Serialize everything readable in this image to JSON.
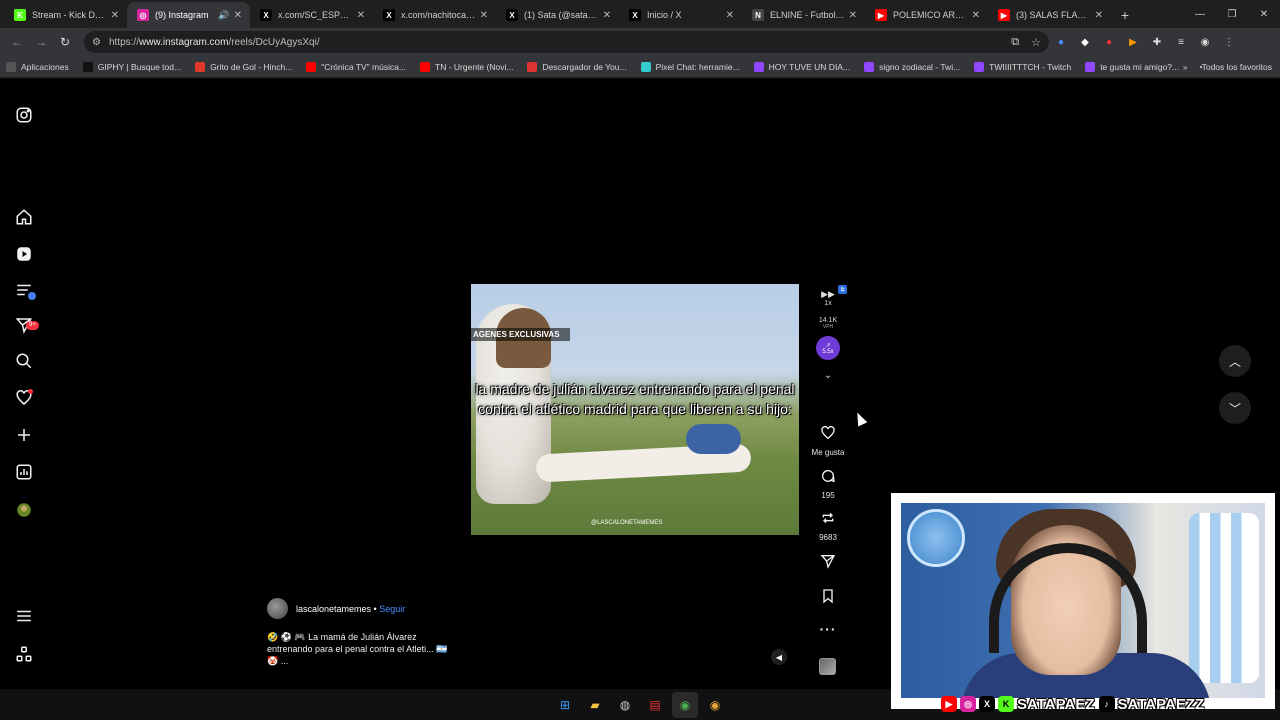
{
  "browser": {
    "tabs": [
      {
        "title": "Stream - Kick Dashbo",
        "color": "#53fc18",
        "glyph": "K",
        "active": false
      },
      {
        "title": "(9) Instagram",
        "color": "#d6249f",
        "glyph": "◎",
        "active": true
      },
      {
        "title": "x.com/SC_ESPN/statu",
        "color": "#000000",
        "glyph": "X",
        "active": false
      },
      {
        "title": "x.com/nachitocarp_/",
        "color": "#000000",
        "glyph": "X",
        "active": false
      },
      {
        "title": "(1) Sata (@satapaez)",
        "color": "#000000",
        "glyph": "X",
        "active": false
      },
      {
        "title": "Inicio / X",
        "color": "#000000",
        "glyph": "X",
        "active": false
      },
      {
        "title": "ELNINE - Futbol en V",
        "color": "#444444",
        "glyph": "N",
        "active": false
      },
      {
        "title": "POLEMICO ARBITRAJ",
        "color": "#ff0000",
        "glyph": "▶",
        "active": false
      },
      {
        "title": "(3) SALAS FLACO, BH",
        "color": "#ff0000",
        "glyph": "▶",
        "active": false
      }
    ],
    "url_prefix": "https://",
    "url_host": "www.instagram.com",
    "url_path": "/reels/DcUyAgysXqi/",
    "bookmarks": [
      {
        "label": "Aplicaciones",
        "color": "#555555"
      },
      {
        "label": "GIPHY | Busque tod...",
        "color": "#111111"
      },
      {
        "label": "Grito de Gol - Hinch...",
        "color": "#e0392b"
      },
      {
        "label": "\"Crónica TV\" música...",
        "color": "#ff0000"
      },
      {
        "label": "TN - Urgente (Novi...",
        "color": "#ff0000"
      },
      {
        "label": "Descargador de You...",
        "color": "#d33"
      },
      {
        "label": "Pixel Chat: herramie...",
        "color": "#3cc"
      },
      {
        "label": "HOY TUVE UN DIA...",
        "color": "#9146ff"
      },
      {
        "label": "signo zodiacal - Twi...",
        "color": "#9146ff"
      },
      {
        "label": "TWIIIITTTCH - Twitch",
        "color": "#9146ff"
      },
      {
        "label": "te gusta mi amigo?...",
        "color": "#9146ff"
      }
    ],
    "all_bookmarks_label": "Todos los favoritos"
  },
  "reel": {
    "overlay_label": "AGENES EXCLUSIVAS",
    "caption": "la madre de julián alvarez entrenando para el penal contra el atlético madrid para que liberen a su hijo:",
    "watermark": "@LASCALONETAMEMES",
    "author": "lascalonetamemes",
    "follow": "Seguir",
    "description": "🤣 ⚽ 🎮 La mamá de Julián Álvarez entrenando para el penal contra el Atleti... 🇦🇷 🤡 ..."
  },
  "actions": {
    "speed": "1x",
    "vph_value": "14.1K",
    "vph_unit": "VPH",
    "boost": "5.5x",
    "likes_label": "Me gusta",
    "comments": "195",
    "reposts": "9683"
  },
  "stream_overlay": {
    "handle_left": "SATAPAEZ",
    "handle_right": "SATAPAEZZ"
  }
}
